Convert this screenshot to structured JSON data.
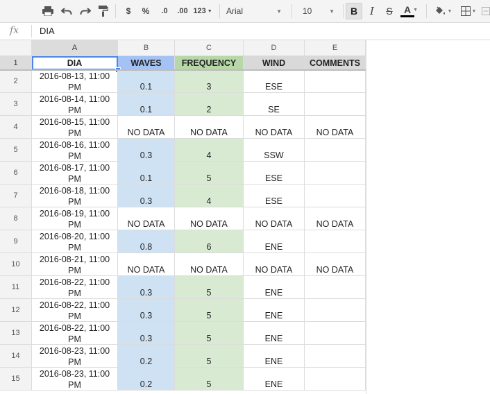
{
  "toolbar": {
    "currency": "$",
    "percent": "%",
    "dec_less": ".0",
    "dec_more": ".00",
    "number_format": "123",
    "font": "Arial",
    "font_size": "10",
    "bold": "B",
    "italic": "I",
    "strike": "S",
    "text_color": "A",
    "text_color_value": "#000000"
  },
  "formula_bar": {
    "fx_label": "fx",
    "value": "DIA"
  },
  "columns": [
    "A",
    "B",
    "C",
    "D",
    "E"
  ],
  "headers": [
    "DIA",
    "WAVES",
    "FREQUENCY",
    "WIND",
    "COMMENTS"
  ],
  "rows": [
    {
      "num": "1"
    },
    {
      "num": "2",
      "date_line1": "2016-08-13, 11:00",
      "date_line2": "PM",
      "waves": "0.1",
      "frequency": "3",
      "wind": "ESE",
      "comments": ""
    },
    {
      "num": "3",
      "date_line1": "2016-08-14, 11:00",
      "date_line2": "PM",
      "waves": "0.1",
      "frequency": "2",
      "wind": "SE",
      "comments": ""
    },
    {
      "num": "4",
      "date_line1": "2016-08-15, 11:00",
      "date_line2": "PM",
      "waves": "NO DATA",
      "frequency": "NO DATA",
      "wind": "NO DATA",
      "comments": "NO DATA"
    },
    {
      "num": "5",
      "date_line1": "2016-08-16, 11:00",
      "date_line2": "PM",
      "waves": "0.3",
      "frequency": "4",
      "wind": "SSW",
      "comments": ""
    },
    {
      "num": "6",
      "date_line1": "2016-08-17, 11:00",
      "date_line2": "PM",
      "waves": "0.1",
      "frequency": "5",
      "wind": "ESE",
      "comments": ""
    },
    {
      "num": "7",
      "date_line1": "2016-08-18, 11:00",
      "date_line2": "PM",
      "waves": "0.3",
      "frequency": "4",
      "wind": "ESE",
      "comments": ""
    },
    {
      "num": "8",
      "date_line1": "2016-08-19, 11:00",
      "date_line2": "PM",
      "waves": "NO DATA",
      "frequency": "NO DATA",
      "wind": "NO DATA",
      "comments": "NO DATA"
    },
    {
      "num": "9",
      "date_line1": "2016-08-20, 11:00",
      "date_line2": "PM",
      "waves": "0.8",
      "frequency": "6",
      "wind": "ENE",
      "comments": ""
    },
    {
      "num": "10",
      "date_line1": "2016-08-21, 11:00",
      "date_line2": "PM",
      "waves": "NO DATA",
      "frequency": "NO DATA",
      "wind": "NO DATA",
      "comments": "NO DATA"
    },
    {
      "num": "11",
      "date_line1": "2016-08-22, 11:00",
      "date_line2": "PM",
      "waves": "0.3",
      "frequency": "5",
      "wind": "ENE",
      "comments": ""
    },
    {
      "num": "12",
      "date_line1": "2016-08-22, 11:00",
      "date_line2": "PM",
      "waves": "0.3",
      "frequency": "5",
      "wind": "ENE",
      "comments": ""
    },
    {
      "num": "13",
      "date_line1": "2016-08-22, 11:00",
      "date_line2": "PM",
      "waves": "0.3",
      "frequency": "5",
      "wind": "ENE",
      "comments": ""
    },
    {
      "num": "14",
      "date_line1": "2016-08-23, 11:00",
      "date_line2": "PM",
      "waves": "0.2",
      "frequency": "5",
      "wind": "ENE",
      "comments": ""
    },
    {
      "num": "15",
      "date_line1": "2016-08-23, 11:00",
      "date_line2": "PM",
      "waves": "0.2",
      "frequency": "5",
      "wind": "ENE",
      "comments": ""
    }
  ],
  "colors": {
    "waves_fill": "#cfe2f3",
    "waves_header_fill": "#a4c2f4",
    "frequency_fill": "#d9ead3",
    "frequency_header_fill": "#b6d7a8",
    "header_fill": "#d9d9d9",
    "selection": "#4a86e8"
  },
  "icons": [
    "print-icon",
    "undo-icon",
    "redo-icon",
    "paint-format-icon",
    "fill-color-icon",
    "borders-icon",
    "merge-cells-icon"
  ]
}
